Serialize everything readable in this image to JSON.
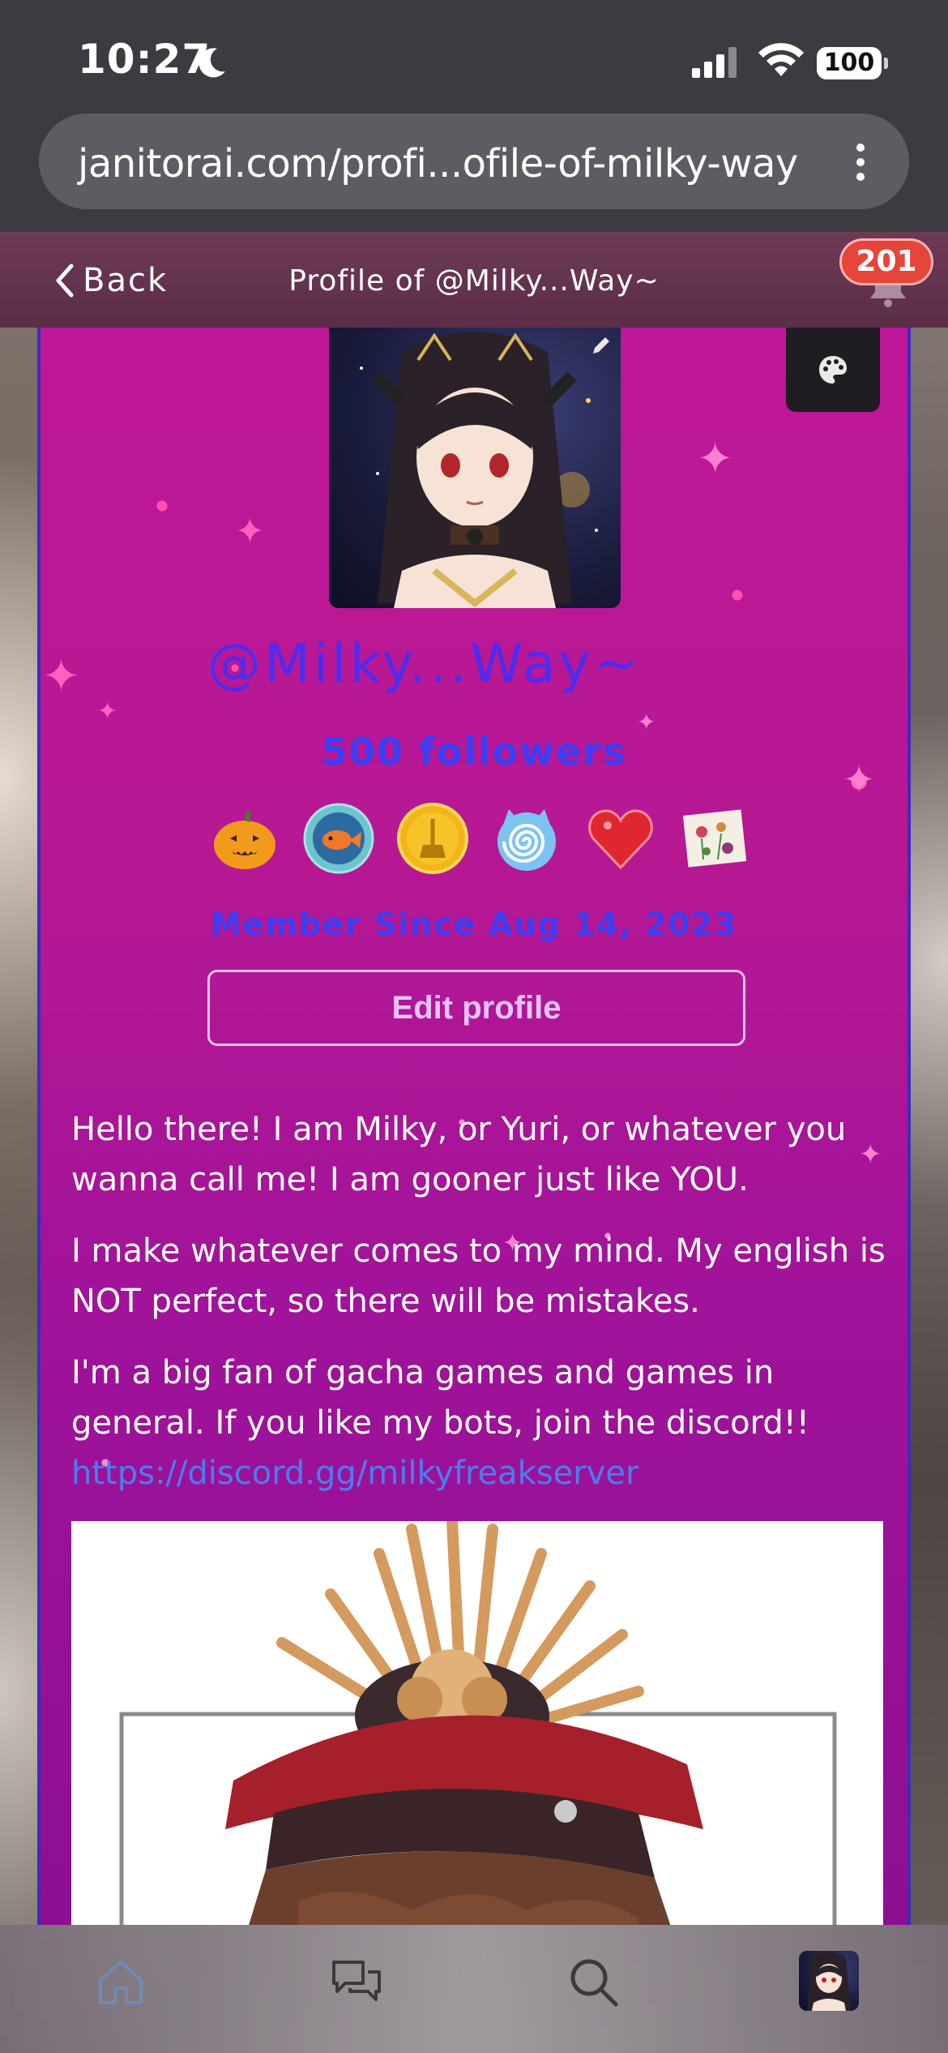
{
  "status_bar": {
    "time": "10:27",
    "battery": "100",
    "icons": [
      "moon-icon",
      "signal-icon",
      "wifi-icon",
      "battery-icon"
    ]
  },
  "browser": {
    "url": "janitorai.com/profi...ofile-of-milky-way",
    "menu_icon": "more-vertical-icon"
  },
  "header": {
    "back_label": "Back",
    "title": "Profile of @Milky...Way~",
    "notification_count": "201",
    "icons": [
      "chevron-left-icon",
      "bell-icon"
    ]
  },
  "profile": {
    "username": "@Milky...Way~",
    "followers": "500 followers",
    "member_since": "Member Since Aug 14, 2023",
    "edit_profile_label": "Edit profile",
    "badges": [
      "pumpkin-badge",
      "goldfish-badge",
      "broom-coin-badge",
      "spiral-cat-badge",
      "heart-badge",
      "flowers-badge"
    ],
    "colors": {
      "card_background": "#b8168f",
      "username_color": "#4d2cf0",
      "followers_color": "#3b3ef5",
      "link_color": "#4a7df0"
    },
    "bio": {
      "paragraph1": "Hello there! I am Milky, or Yuri, or whatever you wanna call me! I am gooner just like YOU.",
      "paragraph2": "I make whatever comes to my mind. My english is NOT perfect, so there will be mistakes.",
      "paragraph3": "I'm a big fan of gacha games and games in general. If you like my bots, join the discord!!",
      "link": "https://discord.gg/milkyfreakserver"
    }
  },
  "bottom_nav": {
    "items": [
      "home-icon",
      "chats-icon",
      "search-icon",
      "profile-avatar"
    ]
  }
}
